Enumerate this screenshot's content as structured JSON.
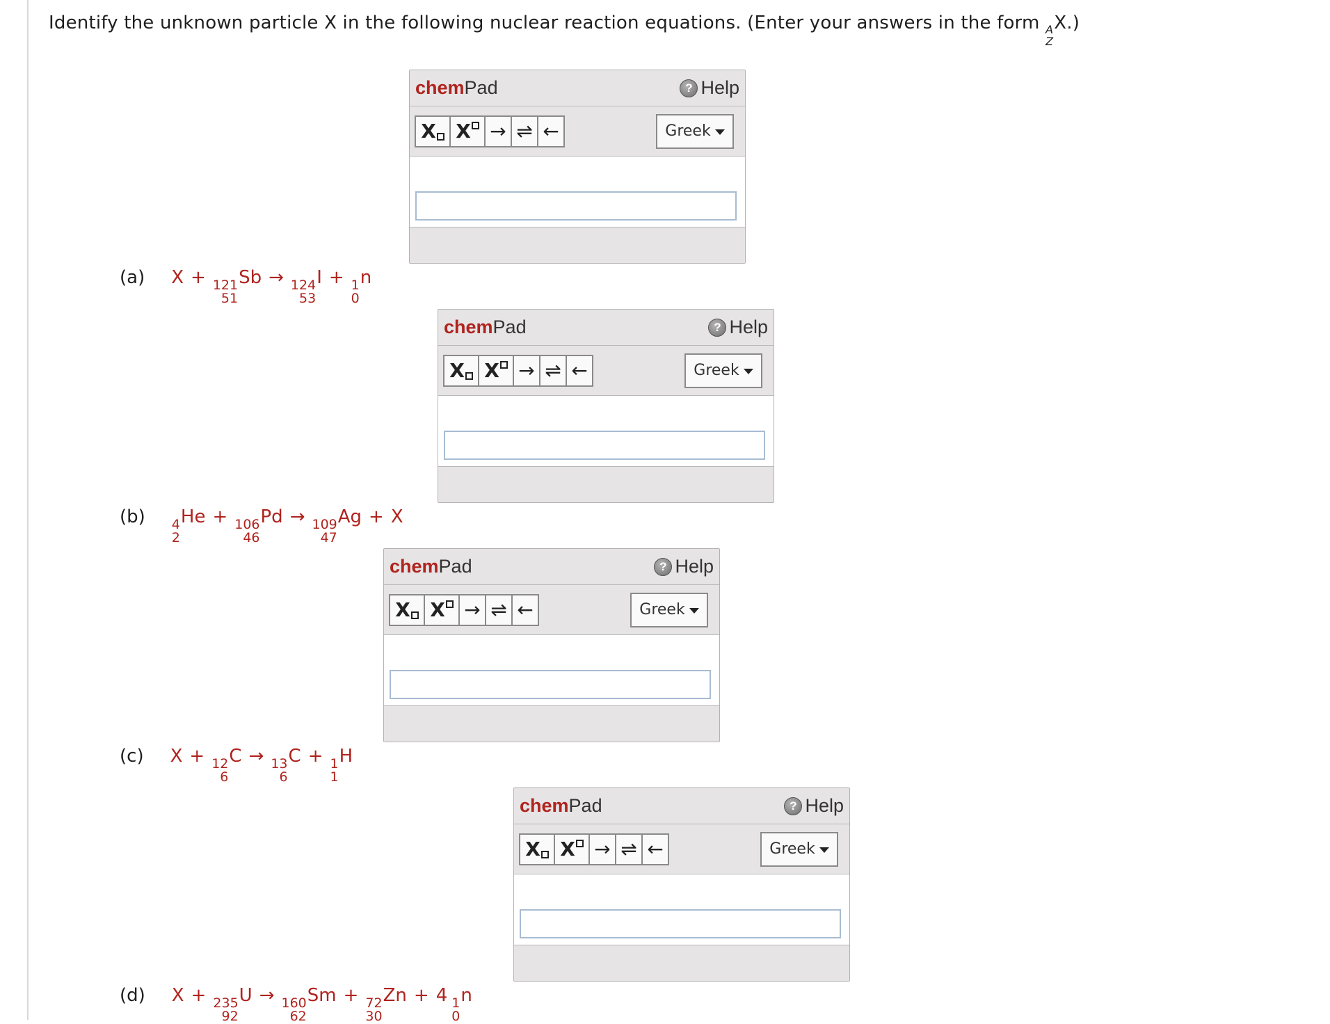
{
  "question": {
    "text": "Identify the unknown particle X in the following nuclear reaction equations. (Enter your answers in the form",
    "form_A": "A",
    "form_Z": "Z",
    "form_X": "X",
    "form_end": ".)"
  },
  "chempad": {
    "title_chem": "chem",
    "title_pad": "Pad",
    "help_label": "Help",
    "arrow_right": "→",
    "arrow_equil": "⇌",
    "arrow_left": "←",
    "greek_label": "Greek",
    "sub_label": "X",
    "sup_label": "X"
  },
  "equations": [
    {
      "label": "(a)",
      "terms": [
        {
          "type": "x",
          "text": "X"
        },
        {
          "type": "op",
          "text": "+"
        },
        {
          "type": "nuc",
          "A": "121",
          "Z": "51",
          "sym": "Sb"
        },
        {
          "type": "op",
          "text": "→"
        },
        {
          "type": "nuc",
          "A": "124",
          "Z": "53",
          "sym": "I"
        },
        {
          "type": "op",
          "text": "+"
        },
        {
          "type": "nuc",
          "A": "1",
          "Z": "0",
          "sym": "n"
        }
      ]
    },
    {
      "label": "(b)",
      "terms": [
        {
          "type": "nuc",
          "A": "4",
          "Z": "2",
          "sym": "He"
        },
        {
          "type": "op",
          "text": "+"
        },
        {
          "type": "nuc",
          "A": "106",
          "Z": "46",
          "sym": "Pd"
        },
        {
          "type": "op",
          "text": "→"
        },
        {
          "type": "nuc",
          "A": "109",
          "Z": "47",
          "sym": "Ag"
        },
        {
          "type": "op",
          "text": "+"
        },
        {
          "type": "x",
          "text": "X"
        }
      ]
    },
    {
      "label": "(c)",
      "terms": [
        {
          "type": "x",
          "text": "X"
        },
        {
          "type": "op",
          "text": "+"
        },
        {
          "type": "nuc",
          "A": "12",
          "Z": "6",
          "sym": "C"
        },
        {
          "type": "op",
          "text": "→"
        },
        {
          "type": "nuc",
          "A": "13",
          "Z": "6",
          "sym": "C"
        },
        {
          "type": "op",
          "text": "+"
        },
        {
          "type": "nuc",
          "A": "1",
          "Z": "1",
          "sym": "H"
        }
      ]
    },
    {
      "label": "(d)",
      "terms": [
        {
          "type": "x",
          "text": "X"
        },
        {
          "type": "op",
          "text": "+"
        },
        {
          "type": "nuc",
          "A": "235",
          "Z": "92",
          "sym": "U"
        },
        {
          "type": "op",
          "text": "→"
        },
        {
          "type": "nuc",
          "A": "160",
          "Z": "62",
          "sym": "Sm"
        },
        {
          "type": "op",
          "text": "+"
        },
        {
          "type": "nuc",
          "A": "72",
          "Z": "30",
          "sym": "Zn"
        },
        {
          "type": "op",
          "text": "+"
        },
        {
          "type": "coef",
          "text": "4"
        },
        {
          "type": "nuc",
          "A": "1",
          "Z": "0",
          "sym": "n"
        }
      ]
    }
  ],
  "answers": [
    {
      "value": "",
      "placeholder": ""
    },
    {
      "value": "",
      "placeholder": ""
    },
    {
      "value": "",
      "placeholder": ""
    },
    {
      "value": "",
      "placeholder": ""
    }
  ],
  "colors": {
    "brand_red": "#b0231e",
    "panel_gray": "#e6e4e5",
    "input_border": "#a8bcd2"
  }
}
